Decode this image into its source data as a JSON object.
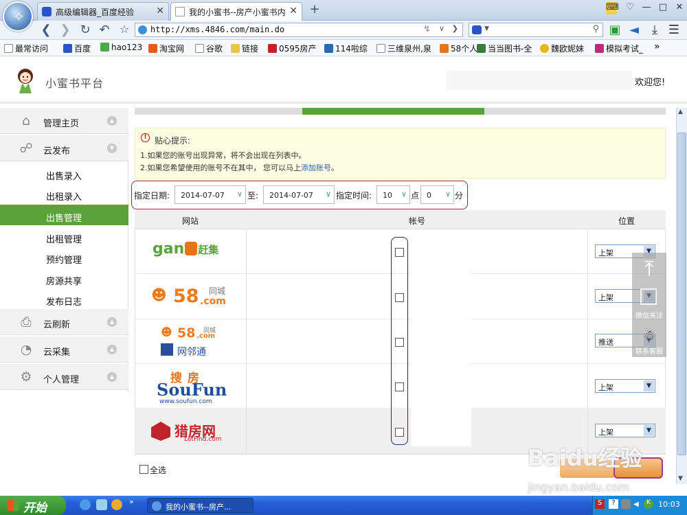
{
  "browser": {
    "tabs": [
      {
        "label": "高级编辑器_百度经验",
        "active": false
      },
      {
        "label": "我的小蜜书--房产小蜜书内",
        "active": true
      }
    ],
    "url": "http://xms.4846.com/main.do",
    "bookmarks": [
      "最常访问",
      "百度",
      "hao123",
      "淘宝网",
      "谷歌",
      "链接",
      "0595房产",
      "114啦综",
      "三维泉州,泉",
      "58个人",
      "当当图书-全",
      "魏欧妮妹",
      "模拟考试_"
    ]
  },
  "header": {
    "site_title": "小蜜书平台",
    "welcome": "欢迎您!"
  },
  "sidebar": {
    "sections": [
      {
        "label": "管理主页",
        "icon": "home-icon"
      },
      {
        "label": "云发布",
        "icon": "share-icon"
      },
      {
        "label": "云刷新",
        "icon": "printer-icon"
      },
      {
        "label": "云采集",
        "icon": "pie-icon"
      },
      {
        "label": "个人管理",
        "icon": "gear-icon"
      }
    ],
    "items": [
      "出售录入",
      "出租录入",
      "出售管理",
      "出租管理",
      "预约管理",
      "房源共享",
      "发布日志"
    ],
    "active_item": "出售管理"
  },
  "tips": {
    "title": "贴心提示:",
    "line1": "1.如果您的账号出现异常，将不会出现在列表中。",
    "line2_prefix": "2.如果您希望使用的账号不在其中， 您可以马上",
    "line2_link": "添加账号",
    "line2_suffix": "。"
  },
  "schedule": {
    "date_label": "指定日期:",
    "start_date": "2014-07-07",
    "to_label": "至:",
    "end_date": "2014-07-07",
    "time_label": "指定时间:",
    "hour": "10",
    "hour_unit": "点",
    "minute": "0",
    "minute_unit": "分"
  },
  "table": {
    "headers": [
      "网站",
      "帐号",
      "位置"
    ],
    "rows": [
      {
        "site": "ganji",
        "position": "上架"
      },
      {
        "site": "58同城",
        "position": "上架"
      },
      {
        "site": "58网邻通",
        "position": "推送"
      },
      {
        "site": "SouFun",
        "position": "上架"
      },
      {
        "site": "猎房网",
        "position": "上架"
      }
    ]
  },
  "logos": {
    "ganji_text": "gan",
    "ganji_cn": "赶集",
    "tc58_num": "58",
    "tc58_com": ".com",
    "tc58_cn": "同城",
    "wlt_cn": "网邻通",
    "soufun_cn": "搜房",
    "soufun_en": "SouFun",
    "soufun_url": "www.soufun.com",
    "letfind_cn": "猎房网",
    "letfind_en": "LetFind.com"
  },
  "float_panel": {
    "wechat": "微信关注",
    "service": "联系客服"
  },
  "select_all": "全选",
  "watermark": {
    "brand": "Baidu经验",
    "url": "jingyan.baidu.com"
  },
  "taskbar": {
    "start": "开始",
    "task": "我的小蜜书--房产...",
    "clock": "10:03"
  },
  "colors": {
    "accent_green": "#5aa33b",
    "frame_red": "#a2252c",
    "frame_navy": "#1b2f6b"
  }
}
